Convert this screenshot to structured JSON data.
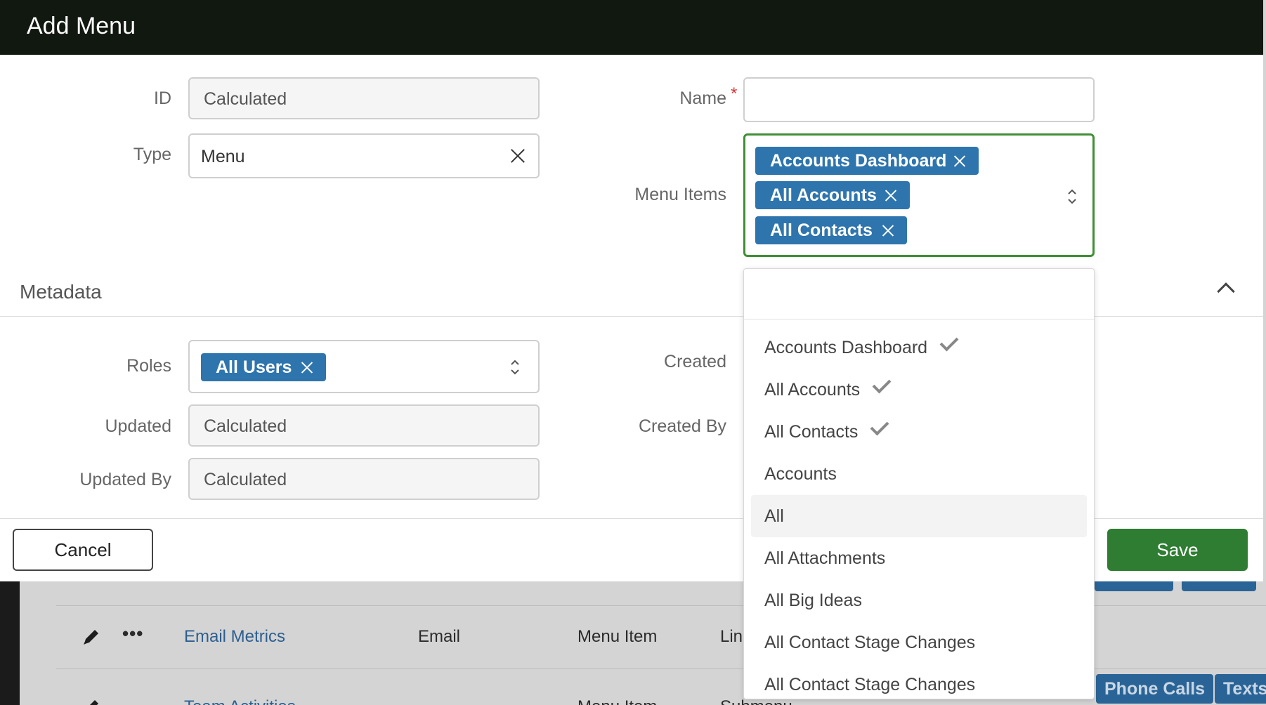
{
  "modal": {
    "title": "Add Menu",
    "fields": {
      "id": {
        "label": "ID",
        "value": "Calculated"
      },
      "type": {
        "label": "Type",
        "value": "Menu"
      },
      "name": {
        "label": "Name",
        "required_mark": "*",
        "value": ""
      },
      "menu_items": {
        "label": "Menu Items",
        "tags": [
          "Accounts Dashboard",
          "All Accounts",
          "All Contacts"
        ]
      }
    },
    "metadata": {
      "title": "Metadata",
      "roles": {
        "label": "Roles",
        "tags": [
          "All Users"
        ]
      },
      "updated": {
        "label": "Updated",
        "value": "Calculated"
      },
      "updated_by": {
        "label": "Updated By",
        "value": "Calculated"
      },
      "created": {
        "label": "Created"
      },
      "created_by": {
        "label": "Created By"
      }
    },
    "buttons": {
      "cancel": "Cancel",
      "save": "Save"
    }
  },
  "dropdown": {
    "search_value": "",
    "options": [
      {
        "label": "Accounts Dashboard",
        "selected": true
      },
      {
        "label": "All Accounts",
        "selected": true
      },
      {
        "label": "All Contacts",
        "selected": true
      },
      {
        "label": "Accounts",
        "selected": false
      },
      {
        "label": "All",
        "selected": false,
        "hovered": true
      },
      {
        "label": "All Attachments",
        "selected": false
      },
      {
        "label": "All Big Ideas",
        "selected": false
      },
      {
        "label": "All Contact Stage Changes",
        "selected": false
      },
      {
        "label": "All Contact Stage Changes",
        "selected": false
      }
    ]
  },
  "background_table": {
    "rows": [
      {
        "name": "Email Metrics",
        "category": "Email",
        "type": "Menu Item",
        "kind": "Lin"
      },
      {
        "name": "Team Activities",
        "category": "",
        "type": "Menu Item",
        "kind": "Submenu"
      }
    ],
    "pills": [
      "Phone Calls",
      "Texts"
    ]
  },
  "colors": {
    "header_bg": "#111810",
    "tag_bg": "#2e75ad",
    "save_bg": "#2e7d32",
    "focus_border": "#3f8f35"
  }
}
